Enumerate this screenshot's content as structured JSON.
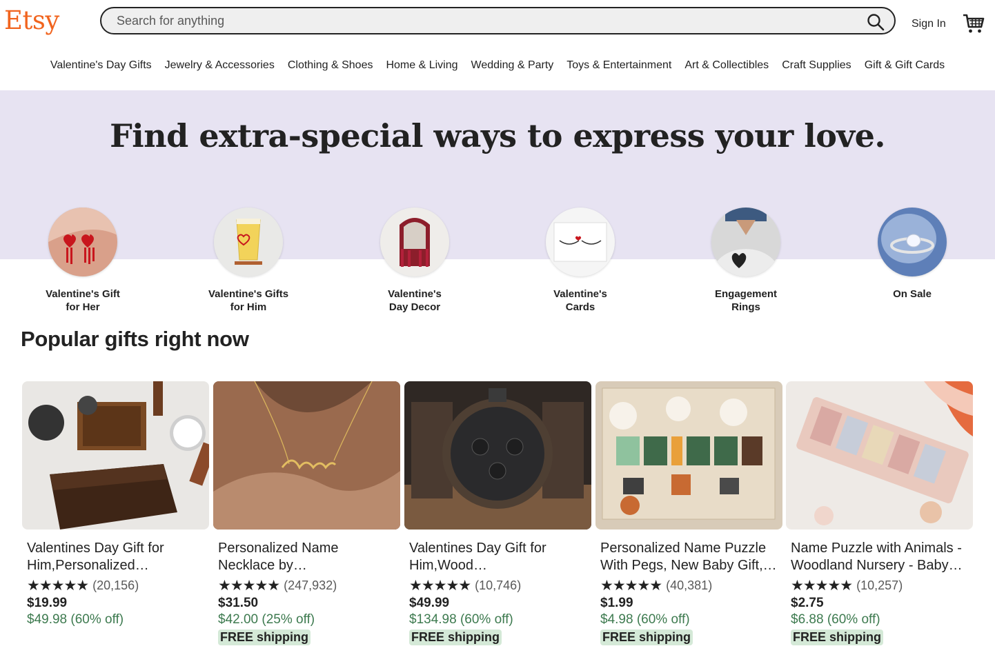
{
  "header": {
    "logo": "Etsy",
    "search_placeholder": "Search for anything",
    "signin_label": "Sign In"
  },
  "nav": {
    "items": [
      "Valentine's Day Gifts",
      "Jewelry & Accessories",
      "Clothing & Shoes",
      "Home & Living",
      "Wedding & Party",
      "Toys & Entertainment",
      "Art & Collectibles",
      "Craft Supplies",
      "Gift & Gift Cards"
    ]
  },
  "hero": {
    "title": "Find extra-special ways to express your love."
  },
  "categories": [
    {
      "label": "Valentine's Gift\nfor Her"
    },
    {
      "label": "Valentine's Gifts\nfor Him"
    },
    {
      "label": "Valentine's\nDay Decor"
    },
    {
      "label": "Valentine's\nCards"
    },
    {
      "label": "Engagement\nRings"
    },
    {
      "label": "On Sale"
    }
  ],
  "popular": {
    "title": "Popular gifts right now",
    "items": [
      {
        "title": "Valentines Day Gift for Him,Personalized…",
        "stars": "★★★★★",
        "reviews": "(20,156)",
        "price": "$19.99",
        "original": "$49.98 (60% off)",
        "shipping": ""
      },
      {
        "title": "Personalized Name Necklace by…",
        "stars": "★★★★★",
        "reviews": "(247,932)",
        "price": "$31.50",
        "original": "$42.00 (25% off)",
        "shipping": "FREE shipping"
      },
      {
        "title": "Valentines Day Gift for Him,Wood…",
        "stars": "★★★★★",
        "reviews": "(10,746)",
        "price": "$49.99",
        "original": "$134.98 (60% off)",
        "shipping": "FREE shipping"
      },
      {
        "title": "Personalized Name Puzzle With Pegs, New Baby Gift,…",
        "stars": "★★★★★",
        "reviews": "(40,381)",
        "price": "$1.99",
        "original": "$4.98 (60% off)",
        "shipping": "FREE shipping"
      },
      {
        "title": "Name Puzzle with Animals - Woodland Nursery - Baby…",
        "stars": "★★★★★",
        "reviews": "(10,257)",
        "price": "$2.75",
        "original": "$6.88 (60% off)",
        "shipping": "FREE shipping"
      }
    ]
  },
  "colors": {
    "brand": "#F1641E",
    "hero_band": "#E7E3F2",
    "discount_green": "#3D7A4F",
    "shipping_badge": "#D4E9D7"
  },
  "icons": [
    "search-icon",
    "cart-icon"
  ]
}
